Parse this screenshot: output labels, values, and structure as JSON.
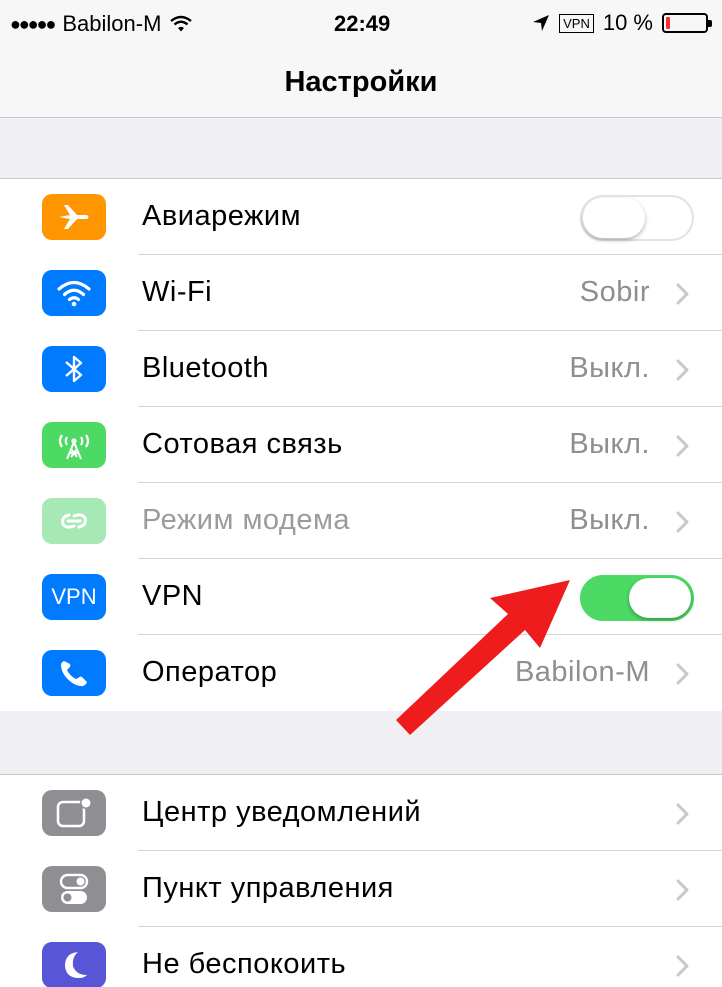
{
  "status_bar": {
    "signal_dots": "●●●●●",
    "carrier": "Babilon-M",
    "time": "22:49",
    "vpn_badge": "VPN",
    "battery_text": "10 %",
    "battery_level": 0.1,
    "battery_color": "#ff2d2d"
  },
  "nav": {
    "title": "Настройки"
  },
  "group1": [
    {
      "label": "Авиарежим",
      "icon": "airplane-icon",
      "color": "#ff9500",
      "toggle": false
    },
    {
      "label": "Wi-Fi",
      "icon": "wifi-icon",
      "color": "#007aff",
      "value": "Sobir"
    },
    {
      "label": "Bluetooth",
      "icon": "bluetooth-icon",
      "color": "#007aff",
      "value": "Выкл."
    },
    {
      "label": "Сотовая связь",
      "icon": "cellular-antenna-icon",
      "color": "#4cd964",
      "value": "Выкл."
    },
    {
      "label": "Режим модема",
      "icon": "hotspot-link-icon",
      "color": "#a6e9b5",
      "value": "Выкл.",
      "dimmed": true
    },
    {
      "label": "VPN",
      "icon": "vpn-icon",
      "icon_text": "VPN",
      "color": "#007aff",
      "toggle": true
    },
    {
      "label": "Оператор",
      "icon": "phone-icon",
      "color": "#007aff",
      "value": "Babilon-M"
    }
  ],
  "group2": [
    {
      "label": "Центр уведомлений",
      "icon": "notification-center-icon",
      "color": "#8e8e93"
    },
    {
      "label": "Пункт управления",
      "icon": "control-center-icon",
      "color": "#8e8e93"
    },
    {
      "label": "Не беспокоить",
      "icon": "moon-icon",
      "color": "#5856d6"
    }
  ],
  "annotation": {
    "arrow_color": "#ee1c1c"
  }
}
